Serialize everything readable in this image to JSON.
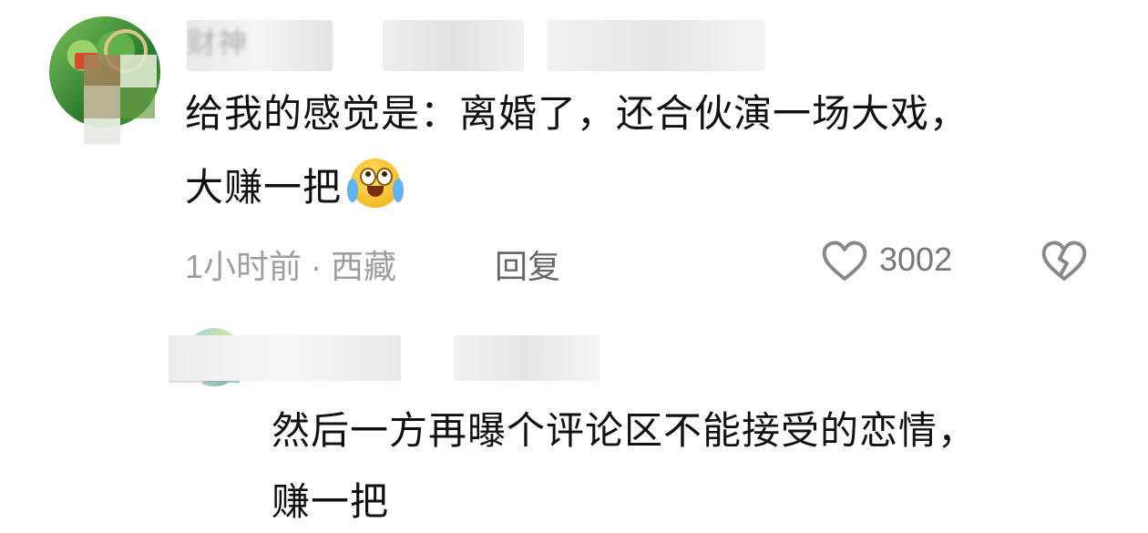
{
  "comment": {
    "username": "财神",
    "text_line1": "给我的感觉是：离婚了，还合伙演一场大戏，",
    "text_line2": "大赚一把",
    "emoji": "crying-laughing-emoji",
    "time_location": "1小时前 · 西藏",
    "reply_label": "回复",
    "like_count": "3002",
    "like_icon": "heart-outline-icon",
    "dislike_icon": "broken-heart-icon"
  },
  "reply": {
    "text_line1": "然后一方再曝个评论区不能接受的恋情，",
    "text_line2": "赚一把"
  },
  "colors": {
    "text": "#111111",
    "meta": "#9e9e9e",
    "icon": "#888888"
  }
}
